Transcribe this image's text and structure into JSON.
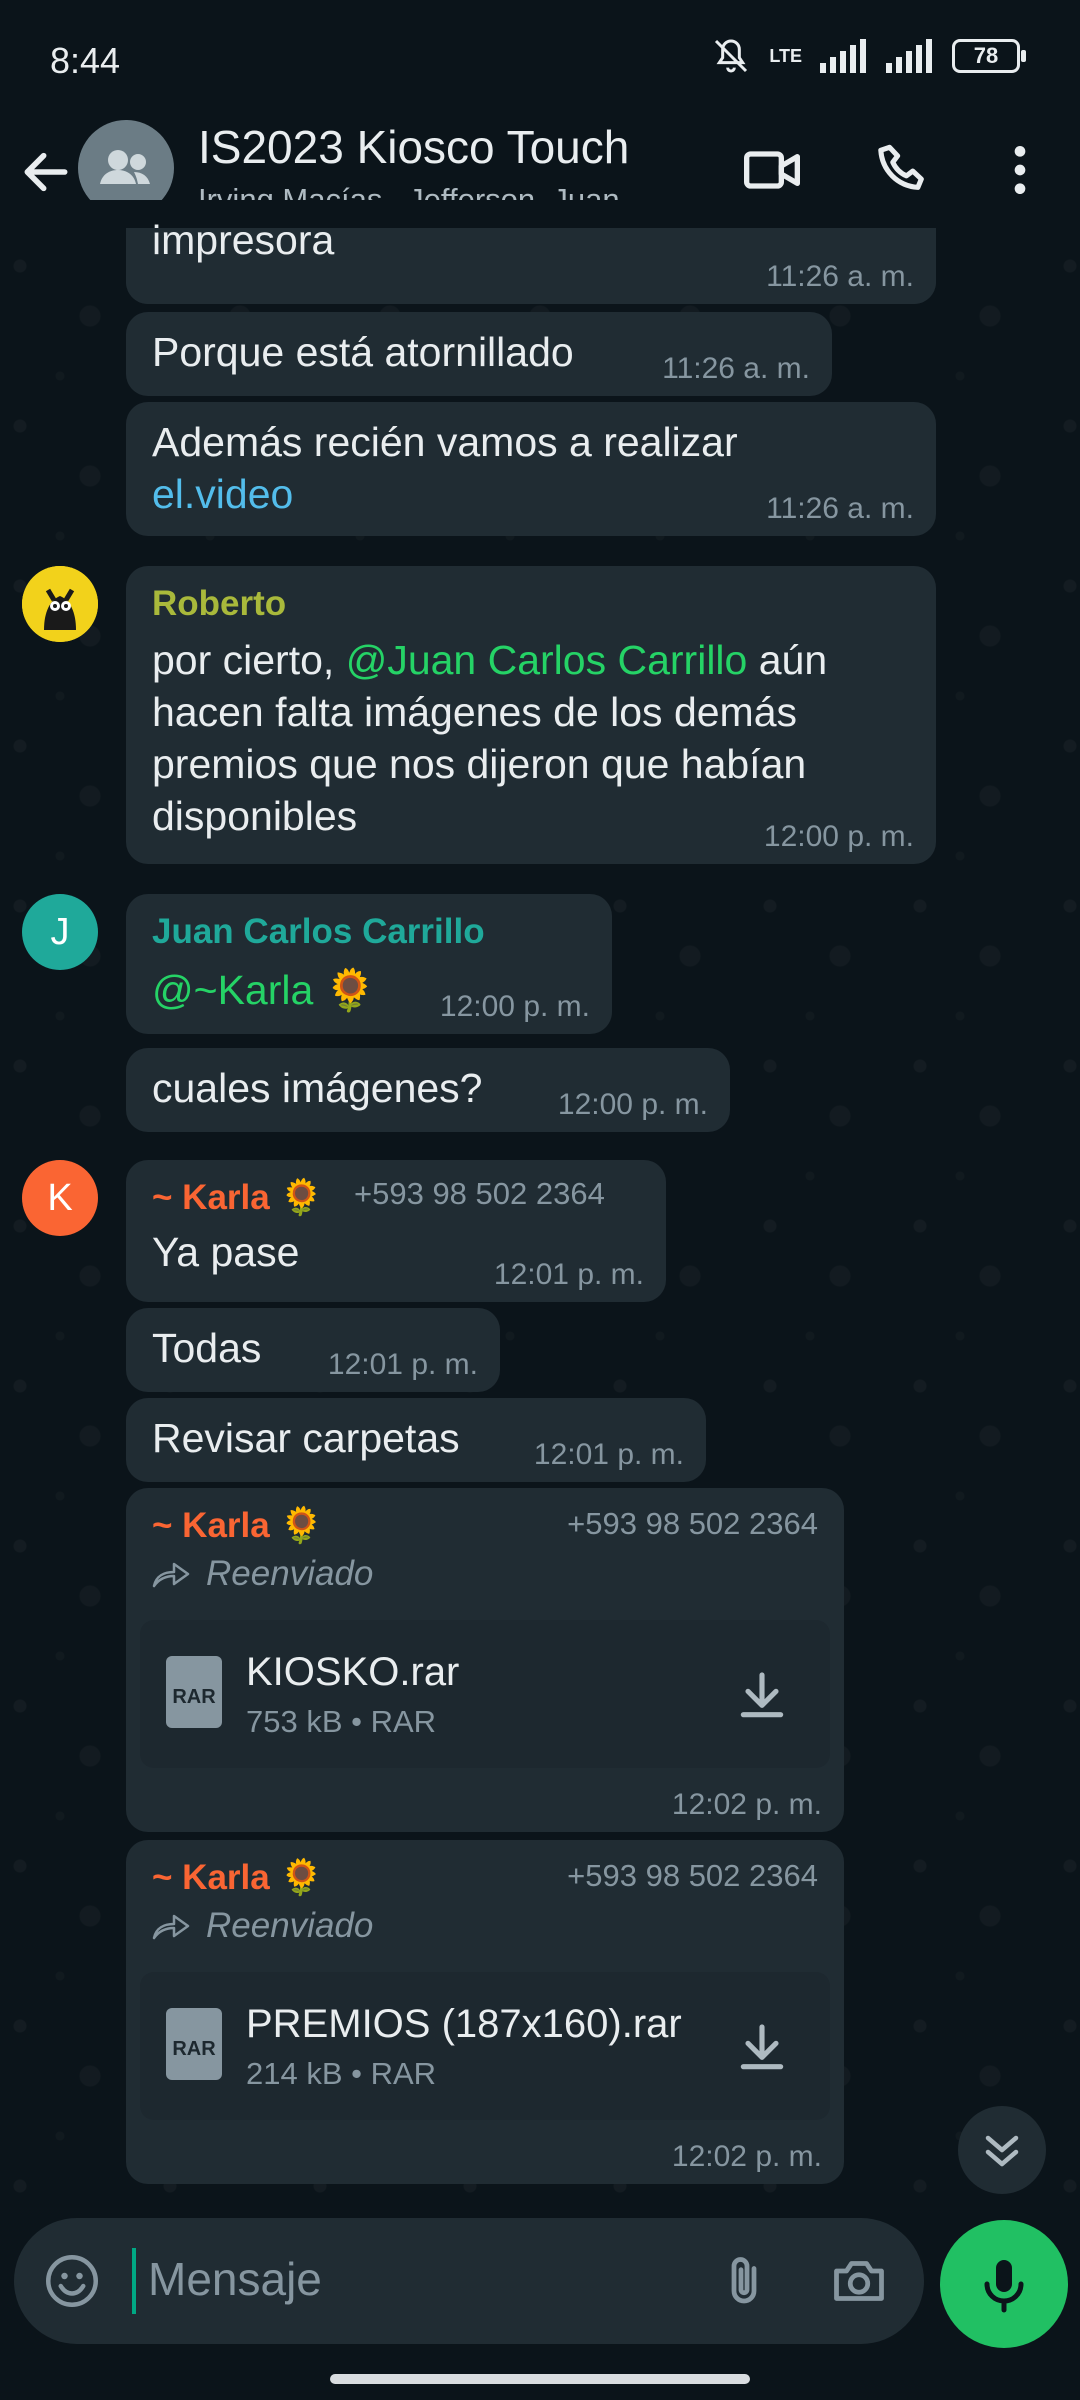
{
  "status": {
    "time": "8:44",
    "network": "LTE",
    "battery": "78"
  },
  "header": {
    "title": "IS2023 Kiosco Touch",
    "subtitle": "Irving Macías , Jefferson, Juan ..."
  },
  "messages": {
    "m1": {
      "text": "impresora",
      "time": "11:26 a. m."
    },
    "m2": {
      "text": "Porque está atornillado",
      "time": "11:26 a. m."
    },
    "m3": {
      "text": "Además recién vamos a realizar",
      "link": "el.video",
      "time": "11:26 a. m."
    },
    "m4": {
      "sender": "Roberto",
      "text_a": "por cierto, ",
      "mention": "@Juan Carlos Carrillo",
      "text_b": " aún hacen falta imágenes de los demás premios que nos dijeron que habían disponibles",
      "time": "12:00 p. m."
    },
    "m5": {
      "sender": "Juan Carlos Carrillo",
      "avatar_letter": "J",
      "mention": "@~Karla 🌻",
      "time": "12:00 p. m."
    },
    "m6": {
      "text": "cuales imágenes?",
      "time": "12:00 p. m."
    },
    "m7": {
      "sender": "~ Karla 🌻",
      "phone": "+593 98 502 2364",
      "avatar_letter": "K",
      "text": "Ya pase",
      "time": "12:01 p. m."
    },
    "m8": {
      "text": "Todas",
      "time": "12:01 p. m."
    },
    "m9": {
      "text": "Revisar carpetas",
      "time": "12:01 p. m."
    },
    "m10": {
      "sender": "~ Karla 🌻",
      "phone": "+593 98 502 2364",
      "forwarded": "Reenviado",
      "file_name": "KIOSKO.rar",
      "file_meta": "753 kB • RAR",
      "file_type": "RAR",
      "time": "12:02 p. m."
    },
    "m11": {
      "sender": "~ Karla 🌻",
      "phone": "+593 98 502 2364",
      "forwarded": "Reenviado",
      "file_name": "PREMIOS (187x160).rar",
      "file_meta": "214 kB • RAR",
      "file_type": "RAR",
      "time": "12:02 p. m."
    }
  },
  "input": {
    "placeholder": "Mensaje"
  },
  "colors": {
    "background": "#0b141a",
    "bubble": "#202c33",
    "roberto": "#a9b93b",
    "juan": "#1fa99a",
    "karla": "#fa6533",
    "accent": "#21c063",
    "link": "#53bdeb"
  }
}
